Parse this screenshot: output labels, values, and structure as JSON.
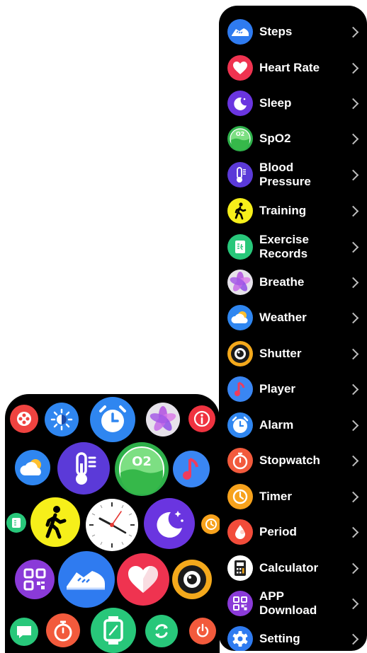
{
  "menu": {
    "items": [
      {
        "label": "Steps",
        "icon": "steps-icon"
      },
      {
        "label": "Heart Rate",
        "icon": "heart-icon"
      },
      {
        "label": "Sleep",
        "icon": "sleep-moon-icon"
      },
      {
        "label": "SpO2",
        "icon": "spo2-icon"
      },
      {
        "label": "Blood\nPressure",
        "icon": "blood-pressure-thermometer-icon"
      },
      {
        "label": "Training",
        "icon": "training-walker-icon"
      },
      {
        "label": "Exercise\nRecords",
        "icon": "exercise-records-icon"
      },
      {
        "label": "Breathe",
        "icon": "breathe-flower-icon"
      },
      {
        "label": "Weather",
        "icon": "weather-cloud-icon"
      },
      {
        "label": "Shutter",
        "icon": "shutter-camera-icon"
      },
      {
        "label": "Player",
        "icon": "music-note-icon"
      },
      {
        "label": "Alarm",
        "icon": "alarm-clock-icon"
      },
      {
        "label": "Stopwatch",
        "icon": "stopwatch-icon"
      },
      {
        "label": "Timer",
        "icon": "timer-icon"
      },
      {
        "label": "Period",
        "icon": "period-drop-icon"
      },
      {
        "label": "Calculator",
        "icon": "calculator-icon"
      },
      {
        "label": "APP\nDownload",
        "icon": "qr-code-icon"
      },
      {
        "label": "Setting",
        "icon": "gear-icon"
      }
    ]
  },
  "spo2_badge": "O2",
  "colors": {
    "background": "#000000",
    "label": "#ffffff",
    "chevron": "#bdbdbd"
  }
}
